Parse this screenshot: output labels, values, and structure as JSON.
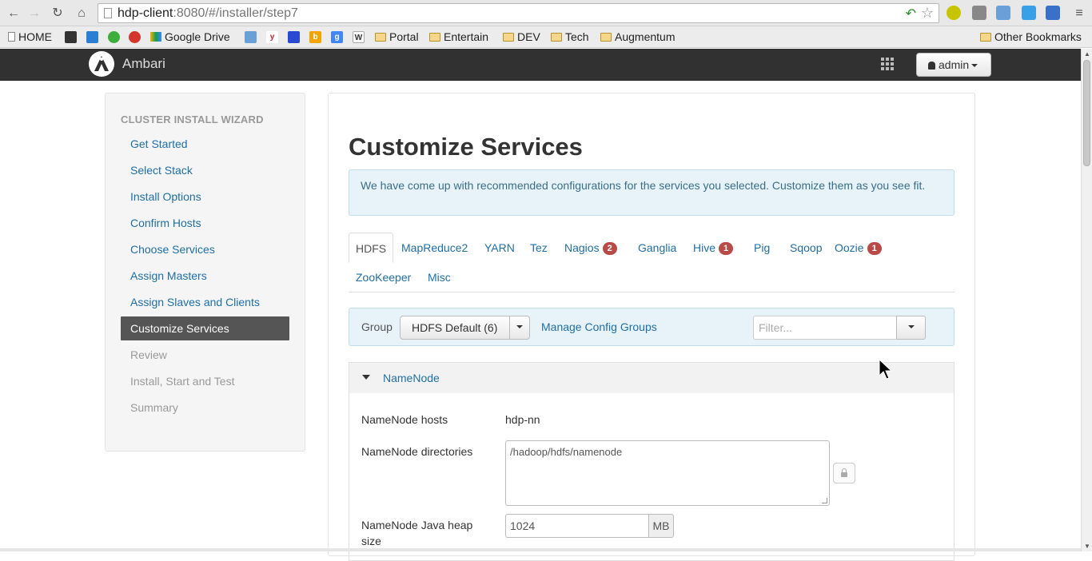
{
  "browser": {
    "url_host": "hdp-client",
    "url_rest": ":8080/#/installer/step7",
    "bookmarks": [
      "HOME",
      "Google Drive",
      "Portal",
      "Entertain",
      "DEV",
      "Tech",
      "Augmentum"
    ],
    "other_bookmarks": "Other Bookmarks"
  },
  "header": {
    "brand": "Ambari",
    "user": "admin"
  },
  "sidebar": {
    "title": "CLUSTER INSTALL WIZARD",
    "steps": [
      {
        "label": "Get Started",
        "state": "link"
      },
      {
        "label": "Select Stack",
        "state": "link"
      },
      {
        "label": "Install Options",
        "state": "link"
      },
      {
        "label": "Confirm Hosts",
        "state": "link"
      },
      {
        "label": "Choose Services",
        "state": "link"
      },
      {
        "label": "Assign Masters",
        "state": "link"
      },
      {
        "label": "Assign Slaves and Clients",
        "state": "link"
      },
      {
        "label": "Customize Services",
        "state": "active"
      },
      {
        "label": "Review",
        "state": "disabled"
      },
      {
        "label": "Install, Start and Test",
        "state": "disabled"
      },
      {
        "label": "Summary",
        "state": "disabled"
      }
    ]
  },
  "main": {
    "title": "Customize Services",
    "alert": "We have come up with recommended configurations for the services you selected. Customize them as you see fit.",
    "tabs": [
      {
        "label": "HDFS"
      },
      {
        "label": "MapReduce2"
      },
      {
        "label": "YARN"
      },
      {
        "label": "Tez"
      },
      {
        "label": "Nagios",
        "badge": "2"
      },
      {
        "label": "Ganglia"
      },
      {
        "label": "Hive",
        "badge": "1"
      },
      {
        "label": "Pig"
      },
      {
        "label": "Sqoop"
      },
      {
        "label": "Oozie",
        "badge": "1"
      },
      {
        "label": "ZooKeeper"
      },
      {
        "label": "Misc"
      }
    ],
    "active_tab": "HDFS",
    "group": {
      "label": "Group",
      "selected": "HDFS Default (6)",
      "manage_link": "Manage Config Groups",
      "filter_placeholder": "Filter..."
    },
    "section": {
      "title": "NameNode",
      "fields": [
        {
          "label": "NameNode hosts",
          "value": "hdp-nn"
        },
        {
          "label": "NameNode directories",
          "value": "/hadoop/hdfs/namenode"
        },
        {
          "label": "NameNode Java heap size",
          "value": "1024",
          "unit": "MB"
        }
      ]
    }
  },
  "colors": {
    "link": "#1e6fa8",
    "header_bg": "#313131",
    "active_step_bg": "#555555",
    "badge": "#b94a48",
    "alert_bg": "#e7f3f9"
  }
}
